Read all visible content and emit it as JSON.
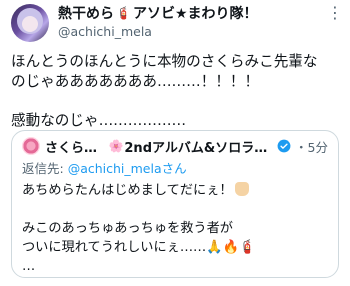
{
  "tweet": {
    "display_name": "熱干めら",
    "display_name_suffix": "アソビ★まわり隊！",
    "handle": "@achichi_mela",
    "more": "⋮",
    "lines": [
      "ほんとうのほんとうに本物のさくらみこ先輩な",
      "のじゃあああああああ………！！！！",
      "感動なのじゃ………………"
    ]
  },
  "quote": {
    "display_name": "さくらみこ",
    "display_name_rest": "2ndアルバム&ソロライ…",
    "time": "・5分",
    "reply_prefix": "返信先: ",
    "reply_mention": "@achichi_melaさん",
    "line1": "あちめらたんはじめましてだにぇ！",
    "line2": "みこのあっちゅあっちゅを救う者が",
    "line3": "ついに現れてうれしいにぇ……",
    "line3_emoji": "🙏🔥🧯",
    "line4": "…"
  },
  "colors": {
    "text": "#0f1419",
    "secondary": "#536471",
    "link": "#1d9bf0",
    "border": "#cfd9de"
  },
  "icons": {
    "more": "more-vertical-icon",
    "verified": "verified-badge-icon",
    "fire_extinguisher": "fire-extinguisher-emoji"
  }
}
